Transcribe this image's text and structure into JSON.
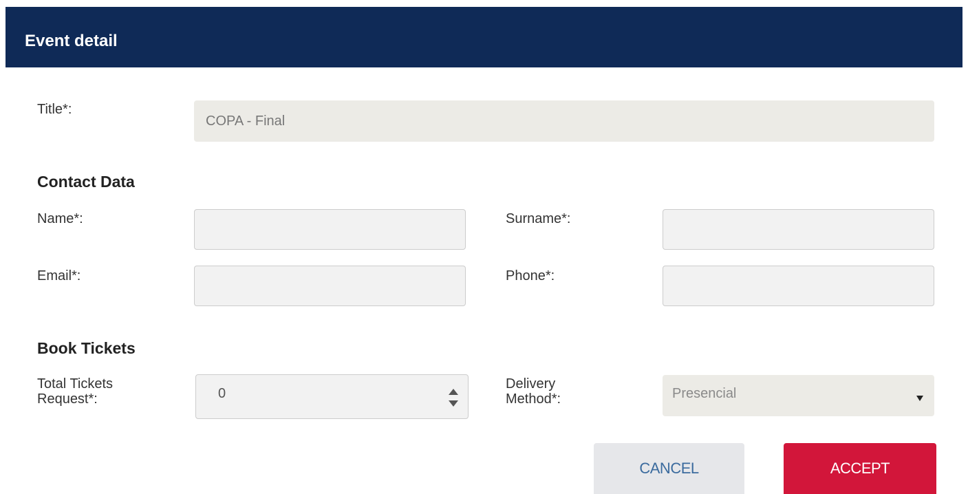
{
  "dialog": {
    "title": "Event detail"
  },
  "form": {
    "title_label": "Title*:",
    "title_value": "COPA - Final",
    "contact_section": "Contact Data",
    "name_label": "Name*:",
    "name_value": "",
    "surname_label": "Surname*:",
    "surname_value": "",
    "email_label": "Email*:",
    "email_value": "",
    "phone_label": "Phone*:",
    "phone_value": "",
    "tickets_section": "Book Tickets",
    "total_tickets_label_line1": "Total Tickets",
    "total_tickets_label_line2": "Request*:",
    "total_tickets_value": "0",
    "delivery_label_line1": "Delivery",
    "delivery_label_line2": "Method*:",
    "delivery_value": "Presencial"
  },
  "actions": {
    "cancel_label": "CANCEL",
    "accept_label": "ACCEPT"
  },
  "colors": {
    "header_bg": "#0f2a57",
    "accept_bg": "#d2163a",
    "cancel_bg": "#e6e7ea"
  }
}
